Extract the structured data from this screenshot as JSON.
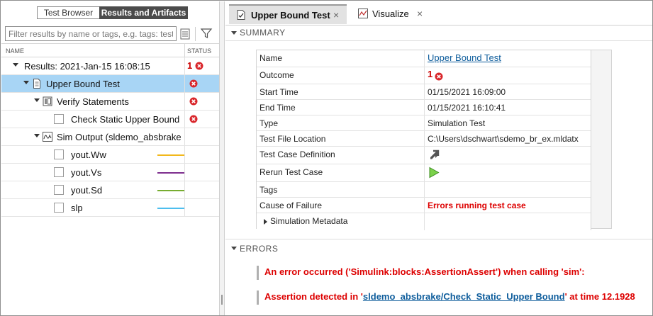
{
  "left": {
    "tabs": [
      {
        "label": "Test Browser"
      },
      {
        "label": "Results and Artifacts"
      }
    ],
    "search": {
      "placeholder": "Filter results by name or tags, e.g. tags: test"
    },
    "columns": {
      "name": "NAME",
      "status": "STATUS"
    },
    "tree": [
      {
        "label": "Results: 2021-Jan-15 16:08:15",
        "status_count": "1"
      },
      {
        "label": "Upper Bound Test"
      },
      {
        "label": "Verify Statements"
      },
      {
        "label": "Check Static Upper Bound"
      },
      {
        "label": "Sim Output (sldemo_absbrake"
      },
      {
        "label": "yout.Ww",
        "color": "#f2b81c"
      },
      {
        "label": "yout.Vs",
        "color": "#7e2f8e"
      },
      {
        "label": "yout.Sd",
        "color": "#77ac30"
      },
      {
        "label": "slp",
        "color": "#4dbeee"
      }
    ]
  },
  "right": {
    "tabs": [
      {
        "label": "Upper Bound Test",
        "close": "×"
      },
      {
        "label": "Visualize",
        "close": "×"
      }
    ],
    "summary_title": "SUMMARY",
    "summary": [
      {
        "key": "Name",
        "value": "Upper Bound Test"
      },
      {
        "key": "Outcome",
        "value": "1"
      },
      {
        "key": "Start Time",
        "value": "01/15/2021 16:09:00"
      },
      {
        "key": "End Time",
        "value": "01/15/2021 16:10:41"
      },
      {
        "key": "Type",
        "value": "Simulation Test"
      },
      {
        "key": "Test File Location",
        "value": "C:\\Users\\dschwart\\sdemo_br_ex.mldatx"
      },
      {
        "key": "Test Case Definition",
        "value": ""
      },
      {
        "key": "Rerun Test Case",
        "value": ""
      },
      {
        "key": "Tags",
        "value": ""
      },
      {
        "key": "Cause of Failure",
        "value": "Errors running test case"
      },
      {
        "key": "Simulation Metadata",
        "value": ""
      }
    ],
    "errors_title": "ERRORS",
    "errors": {
      "line1": "An error occurred ('Simulink:blocks:AssertionAssert') when calling 'sim':",
      "line2_prefix": "Assertion detected in '",
      "line2_link": "sldemo_absbrake/Check_Static_Upper Bound",
      "line2_suffix": "' at time 12.1928"
    }
  },
  "colors": {
    "selected_row": "#a8d5f5",
    "error_red": "#d00000",
    "link_blue": "#0e5d9c"
  }
}
